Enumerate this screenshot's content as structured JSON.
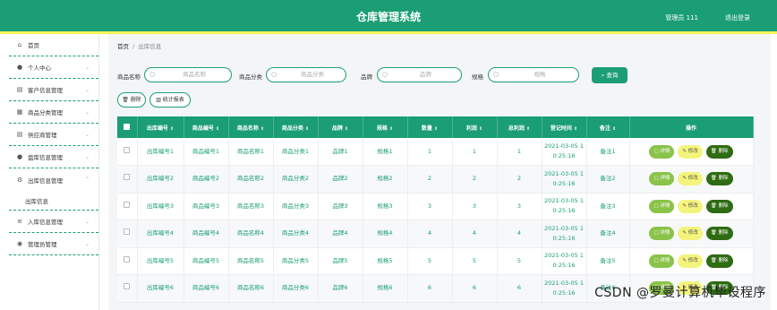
{
  "header": {
    "title": "仓库管理系统",
    "admin": "管理员 111",
    "logout": "退出登录",
    "bg": "#1b9e74",
    "stripe": "#f4f45a"
  },
  "sidebar": {
    "items": [
      {
        "label": "首页",
        "icon": "home-icon"
      },
      {
        "label": "个人中心",
        "icon": "user-icon"
      },
      {
        "label": "客户信息管理",
        "icon": "doc-icon"
      },
      {
        "label": "商品分类管理",
        "icon": "grid-icon"
      },
      {
        "label": "供应商管理",
        "icon": "doc-icon"
      },
      {
        "label": "盘库信息管理",
        "icon": "user-icon"
      },
      {
        "label": "出库信息管理",
        "icon": "gear-icon"
      },
      {
        "label": "入库信息管理",
        "icon": "list-icon"
      },
      {
        "label": "管理员管理",
        "icon": "pin-icon"
      }
    ],
    "sub": "出库信息"
  },
  "breadcrumb": {
    "home": "首页",
    "sep": "/",
    "current": "出库信息"
  },
  "search": {
    "code_label": "商品名称",
    "code_ph": "商品名称",
    "cat_label": "商品分类",
    "cat_ph": "商品分类",
    "brand_label": "品牌",
    "brand_ph": "品牌",
    "spec_label": "规格",
    "spec_ph": "规格",
    "query": "查询"
  },
  "actions": {
    "delete": "删除",
    "stats": "统计报表"
  },
  "table": {
    "headers": [
      "出库编号",
      "商品编号",
      "商品名称",
      "商品分类",
      "品牌",
      "规格",
      "数量",
      "利润",
      "总利润",
      "登记时间",
      "备注",
      "操作"
    ],
    "ops": {
      "detail": "详情",
      "edit": "修改",
      "delete": "删除"
    },
    "rows": [
      [
        "出库编号1",
        "商品编号1",
        "商品名称1",
        "商品分类1",
        "品牌1",
        "规格1",
        "1",
        "1",
        "1",
        "2021-03-05 1\n0:25:16",
        "备注1"
      ],
      [
        "出库编号2",
        "商品编号2",
        "商品名称2",
        "商品分类2",
        "品牌2",
        "规格2",
        "2",
        "2",
        "2",
        "2021-03-05 1\n0:25:16",
        "备注2"
      ],
      [
        "出库编号3",
        "商品编号3",
        "商品名称3",
        "商品分类3",
        "品牌3",
        "规格3",
        "3",
        "3",
        "3",
        "2021-03-05 1\n0:25:16",
        "备注3"
      ],
      [
        "出库编号4",
        "商品编号4",
        "商品名称4",
        "商品分类4",
        "品牌4",
        "规格4",
        "4",
        "4",
        "4",
        "2021-03-05 1\n0:25:16",
        "备注4"
      ],
      [
        "出库编号5",
        "商品编号5",
        "商品名称5",
        "商品分类5",
        "品牌5",
        "规格5",
        "5",
        "5",
        "5",
        "2021-03-05 1\n0:25:16",
        "备注5"
      ],
      [
        "出库编号6",
        "商品编号6",
        "商品名称6",
        "商品分类6",
        "品牌6",
        "规格6",
        "6",
        "6",
        "6",
        "2021-03-05 1\n0:25:16",
        "备注6"
      ]
    ]
  },
  "watermark": "CSDN @罗曼计算机毕设程序"
}
